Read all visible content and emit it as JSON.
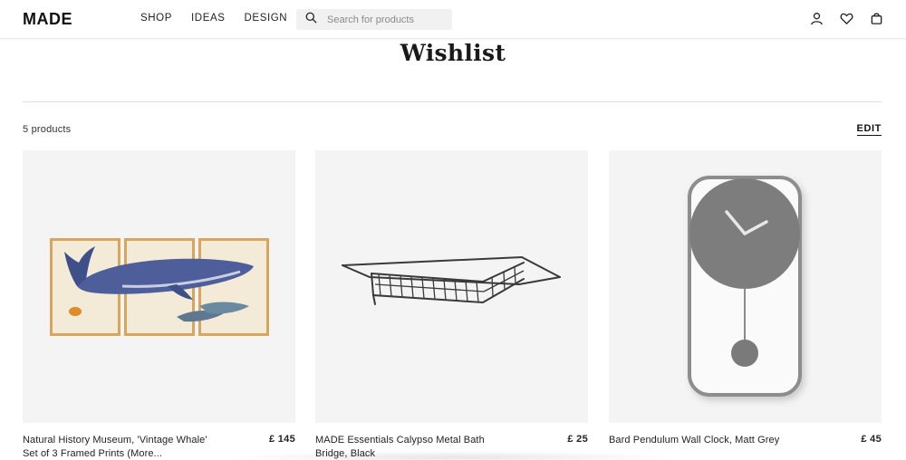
{
  "header": {
    "logo": "MADE",
    "nav": [
      "SHOP",
      "IDEAS",
      "DESIGN"
    ],
    "search_placeholder": "Search for products",
    "icons": [
      "account-icon",
      "wishlist-heart-icon",
      "basket-icon"
    ]
  },
  "page": {
    "title": "Wishlist",
    "count": "5 products",
    "edit_label": "EDIT"
  },
  "products": [
    {
      "name": "Natural History Museum, 'Vintage Whale' Set of 3 Framed Prints (More...",
      "price": "£ 145"
    },
    {
      "name": "MADE Essentials Calypso Metal Bath Bridge, Black",
      "price": "£ 25"
    },
    {
      "name": "Bard Pendulum Wall Clock, Matt Grey",
      "price": "£ 45"
    }
  ]
}
